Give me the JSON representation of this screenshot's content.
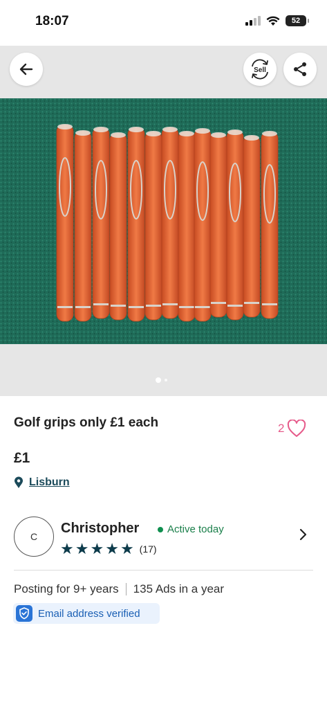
{
  "status_bar": {
    "time": "18:07",
    "battery": "52"
  },
  "header": {
    "sell_label": "Sell"
  },
  "gallery": {
    "image_count": 2,
    "current_index": 1
  },
  "listing": {
    "title": "Golf grips only £1 each",
    "favourite_count": "2",
    "price": "£1",
    "location": "Lisburn"
  },
  "seller": {
    "initial": "C",
    "name": "Christopher",
    "activity": "Active today",
    "rating_stars": 5,
    "rating_count": "(17)",
    "posting_for": "Posting for 9+ years",
    "ads_count": "135 Ads in a year",
    "verified_label": "Email address verified"
  },
  "colors": {
    "accent_pink": "#e65a8a",
    "link_teal": "#1b4a5a",
    "active_green": "#1a7f4a",
    "verified_blue": "#1a5fb4"
  },
  "icons": [
    "back-arrow-icon",
    "sell-icon",
    "share-icon",
    "heart-icon",
    "location-pin-icon",
    "star-icon",
    "chevron-right-icon",
    "shield-check-icon"
  ]
}
